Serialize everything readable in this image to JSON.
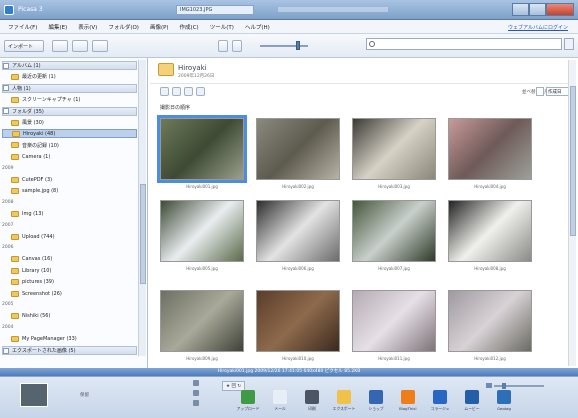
{
  "window": {
    "title": "Picasa 3",
    "title_field": "IMG1023.JPG"
  },
  "menu": {
    "items": [
      "ファイル(F)",
      "編集(E)",
      "表示(V)",
      "フォルダ(O)",
      "画像(P)",
      "作成(C)",
      "ツール(T)",
      "ヘルプ(H)"
    ],
    "help_link": "ウェブアルバムにログイン"
  },
  "toolbar": {
    "import_label": "インポート",
    "search_placeholder": ""
  },
  "sidebar": {
    "items": [
      {
        "label": "アルバム (1)",
        "kind": "header"
      },
      {
        "label": "最近の更新 (1)",
        "kind": "item"
      },
      {
        "label": "人物 (1)",
        "kind": "header"
      },
      {
        "label": "スクリーンキャプチャ (1)",
        "kind": "item"
      },
      {
        "label": "フォルダ (35)",
        "kind": "header"
      },
      {
        "label": "風景 (30)",
        "kind": "item"
      },
      {
        "label": "Hiroyaki (48)",
        "kind": "selected"
      },
      {
        "label": "音楽の記録 (10)",
        "kind": "item"
      },
      {
        "label": "Camera (1)",
        "kind": "item"
      },
      {
        "label": "2009",
        "kind": "year"
      },
      {
        "label": "CutePDF (3)",
        "kind": "item"
      },
      {
        "label": "sample.jpg (8)",
        "kind": "item"
      },
      {
        "label": "2008",
        "kind": "year"
      },
      {
        "label": "Img (13)",
        "kind": "item"
      },
      {
        "label": "2007",
        "kind": "year"
      },
      {
        "label": "Upload (744)",
        "kind": "item"
      },
      {
        "label": "2006",
        "kind": "year"
      },
      {
        "label": "Canvas (16)",
        "kind": "item"
      },
      {
        "label": "Library (10)",
        "kind": "item"
      },
      {
        "label": "pictures (39)",
        "kind": "item"
      },
      {
        "label": "Screenshot (26)",
        "kind": "item"
      },
      {
        "label": "2005",
        "kind": "year"
      },
      {
        "label": "Nishiki (56)",
        "kind": "item"
      },
      {
        "label": "2004",
        "kind": "year"
      },
      {
        "label": "My PageManager (33)",
        "kind": "item"
      },
      {
        "label": "エクスポートされた画像 (5)",
        "kind": "header"
      }
    ]
  },
  "main": {
    "folder_title": "Hiroyaki",
    "folder_date": "2009年12月26日",
    "sort_label": "並べ替え順序",
    "sort_value": "作成日",
    "group_label": "撮影日の順序",
    "thumbnails": [
      {
        "file": "Hiroyaki001.jpg",
        "colors": [
          "#6d7a5a",
          "#3e4a33",
          "#9aa08c"
        ],
        "selected": true
      },
      {
        "file": "Hiroyaki002.jpg",
        "colors": [
          "#8b8a7f",
          "#5d5a4e",
          "#b7b3a5"
        ],
        "selected": false
      },
      {
        "file": "Hiroyaki003.jpg",
        "colors": [
          "#3c3a36",
          "#d6d2c6",
          "#8b877b"
        ],
        "selected": false
      },
      {
        "file": "Hiroyaki004.jpg",
        "colors": [
          "#c89a9a",
          "#6e5a58",
          "#9da09a"
        ],
        "selected": false
      },
      {
        "file": "Hiroyaki005.jpg",
        "colors": [
          "#3d4a36",
          "#e9edf0",
          "#5b6b4a"
        ],
        "selected": false
      },
      {
        "file": "Hiroyaki006.jpg",
        "colors": [
          "#2d2d2d",
          "#e3e3e3",
          "#6b6b6b"
        ],
        "selected": false
      },
      {
        "file": "Hiroyaki007.jpg",
        "colors": [
          "#45563b",
          "#c9d0cc",
          "#2f3a28"
        ],
        "selected": false
      },
      {
        "file": "Hiroyaki008.jpg",
        "colors": [
          "#232323",
          "#f0f0ec",
          "#8a8a86"
        ],
        "selected": false
      },
      {
        "file": "Hiroyaki009.jpg",
        "colors": [
          "#6c6f62",
          "#a9a99a",
          "#3f4238"
        ],
        "selected": false
      },
      {
        "file": "Hiroyaki010.jpg",
        "colors": [
          "#5a3d2a",
          "#8e6a4c",
          "#3a2a1e"
        ],
        "selected": false
      },
      {
        "file": "Hiroyaki011.jpg",
        "colors": [
          "#b5aab3",
          "#e6e0e6",
          "#7d7379"
        ],
        "selected": false
      },
      {
        "file": "Hiroyaki012.jpg",
        "colors": [
          "#9f9aa0",
          "#d8d2d6",
          "#6b6a62"
        ],
        "selected": false
      }
    ]
  },
  "status": {
    "text": "Hiroyaki001.jpg   2009/12/26 17:41:05   640x480 ピクセル   85.2KB"
  },
  "tray": {
    "label": "保留",
    "mini_controls": "★ 回 ↻",
    "actions": [
      {
        "label": "アップロード",
        "icon": "upload-icon",
        "color": "#3f9a45"
      },
      {
        "label": "メール",
        "icon": "email-icon",
        "color": "#e8eef6"
      },
      {
        "label": "印刷",
        "icon": "print-icon",
        "color": "#4b5563"
      },
      {
        "label": "エクスポート",
        "icon": "export-icon",
        "color": "#f0c24a"
      },
      {
        "label": "ショップ",
        "icon": "shop-icon",
        "color": "#3466b3"
      },
      {
        "label": "BlogThis!",
        "icon": "blog-icon",
        "color": "#ef7d1a"
      },
      {
        "label": "コラージュ",
        "icon": "collage-icon",
        "color": "#2a67c4"
      },
      {
        "label": "ムービー",
        "icon": "movie-icon",
        "color": "#245ea8"
      },
      {
        "label": "Geotag",
        "icon": "geotag-icon",
        "color": "#2f6fb8"
      }
    ]
  }
}
